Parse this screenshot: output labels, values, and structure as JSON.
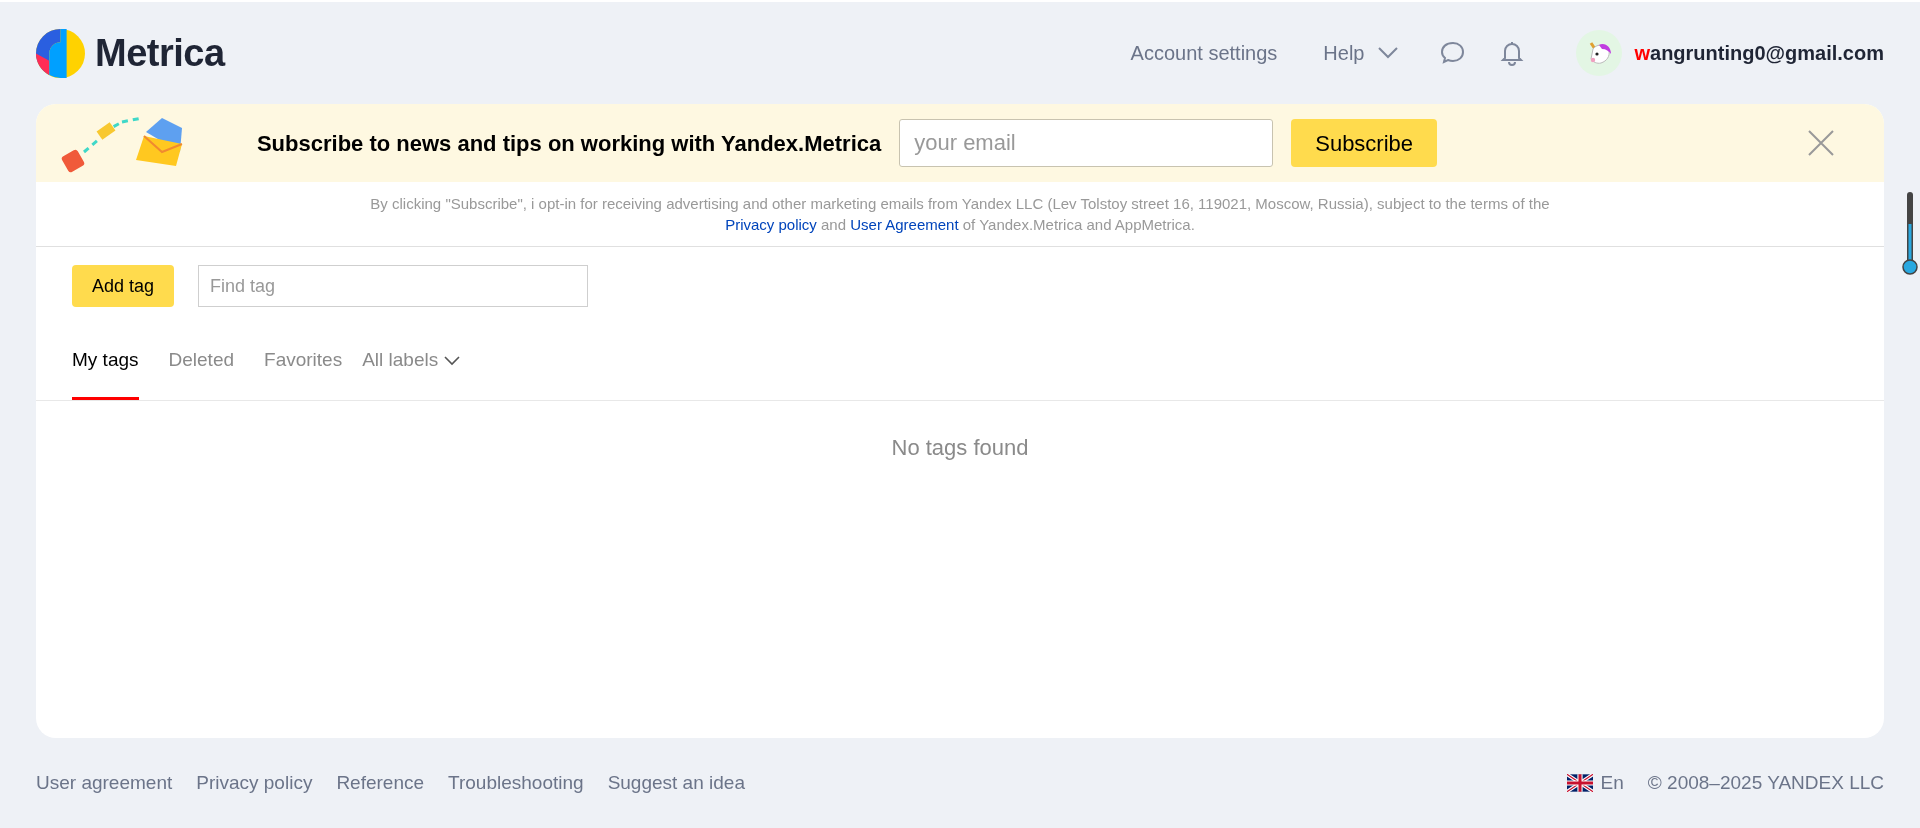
{
  "header": {
    "logo_text": "Metrica",
    "nav": [
      {
        "label": "Account settings",
        "kind": "link"
      },
      {
        "label": "Help",
        "kind": "dropdown"
      }
    ],
    "user": {
      "email_initial": "w",
      "email_rest": "angrunting0@gmail.com"
    }
  },
  "banner": {
    "title": "Subscribe to news and tips on working with Yandex.Metrica",
    "email": {
      "placeholder": "your email"
    },
    "button": "Subscribe"
  },
  "consent": {
    "before": "By clicking \"Subscribe\", i opt-in for receiving advertising and other marketing emails from Yandex LLC (Lev Tolstoy street 16, 119021, Moscow, Russia), subject to the terms of the",
    "link_1": "Privacy policy",
    "middle": "and",
    "link_2": "User Agreement",
    "after": "of Yandex.Metrica and AppMetrica."
  },
  "toolbar": {
    "add_button": "Add tag",
    "search": {
      "placeholder": "Find tag"
    }
  },
  "tabs": [
    {
      "label": "My tags",
      "kind": "tab",
      "selected": true
    },
    {
      "label": "Deleted",
      "kind": "tab",
      "selected": false
    },
    {
      "label": "Favorites",
      "kind": "tab",
      "selected": false
    },
    {
      "label": "All labels",
      "kind": "dropdown",
      "selected": false
    }
  ],
  "empty_message": "No tags found",
  "footer": {
    "links": [
      "User agreement",
      "Privacy policy",
      "Reference",
      "Troubleshooting",
      "Suggest an idea"
    ],
    "language": "En",
    "copyright": "© 2008–2025 YANDEX LLC"
  }
}
